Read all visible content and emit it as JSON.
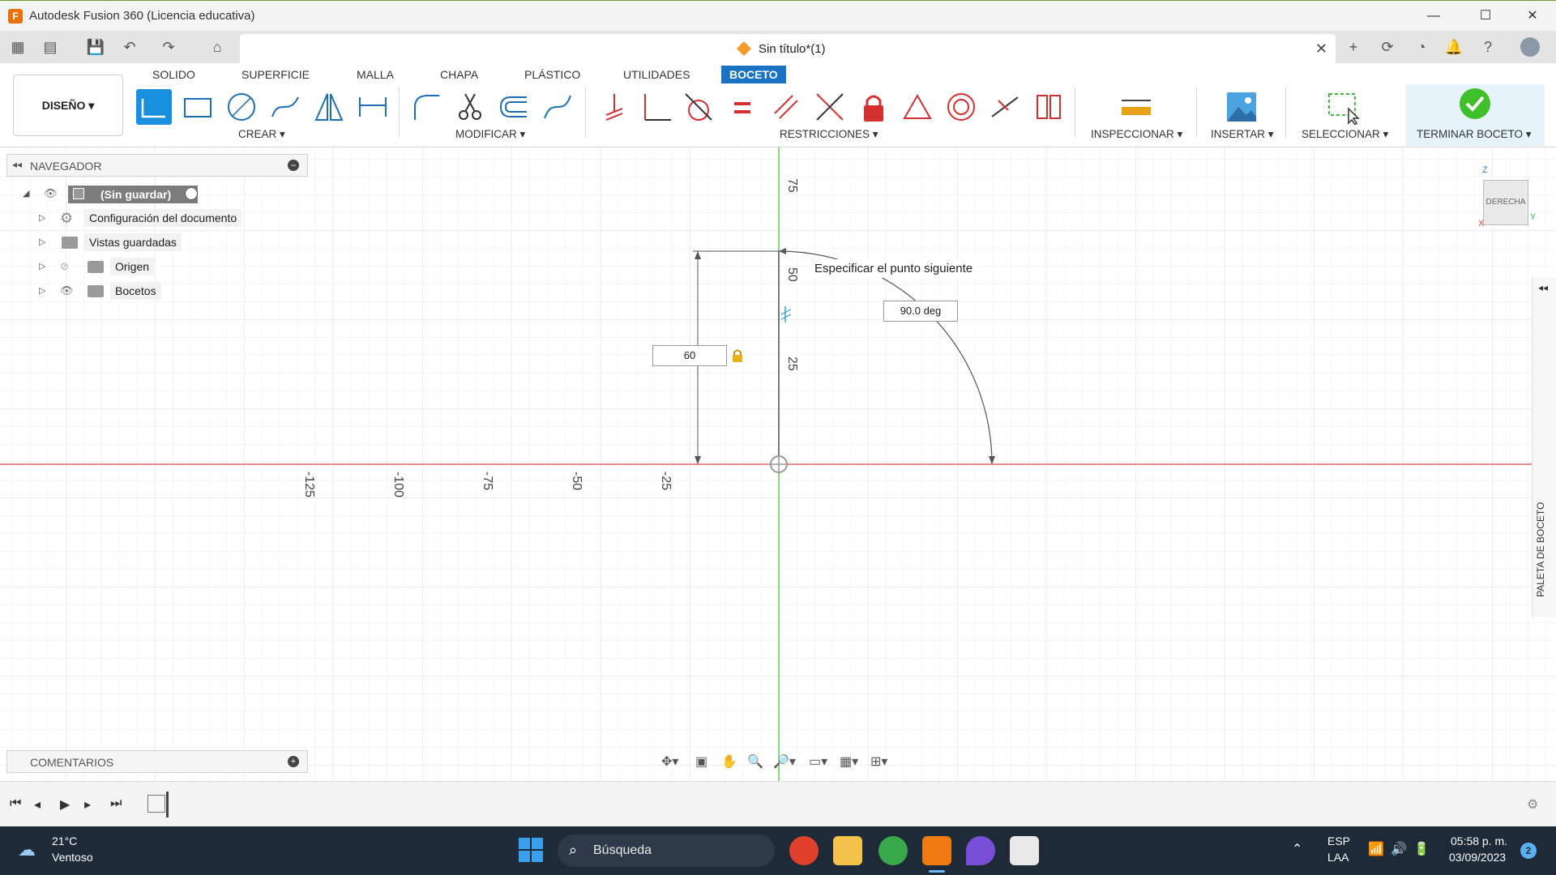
{
  "window": {
    "title": "Autodesk Fusion 360 (Licencia educativa)",
    "app_icon": "F"
  },
  "doc_tab": {
    "title": "Sin título*(1)"
  },
  "ribbon": {
    "workspace": "DISEÑO ▾",
    "tabs": [
      "SOLIDO",
      "SUPERFICIE",
      "MALLA",
      "CHAPA",
      "PLÁSTICO",
      "UTILIDADES",
      "BOCETO"
    ],
    "active_tab": "BOCETO",
    "groups": {
      "crear": "CREAR ▾",
      "modificar": "MODIFICAR ▾",
      "restricciones": "RESTRICCIONES ▾",
      "inspeccionar": "INSPECCIONAR ▾",
      "insertar": "INSERTAR ▾",
      "seleccionar": "SELECCIONAR ▾",
      "terminar": "TERMINAR BOCETO ▾"
    }
  },
  "navigator": {
    "header": "NAVEGADOR",
    "root": "(Sin guardar)",
    "items": [
      "Configuración del documento",
      "Vistas guardadas",
      "Origen",
      "Bocetos"
    ]
  },
  "comments": {
    "header": "COMENTARIOS"
  },
  "sketch": {
    "tooltip": "Especificar el punto siguiente",
    "length_input": "60",
    "angle_input": "90.0 deg",
    "x_ticks": [
      "-125",
      "-100",
      "-75",
      "-50",
      "-25"
    ],
    "y_ticks": [
      "75",
      "50",
      "25"
    ]
  },
  "palette": {
    "label": "PALETA DE BOCETO"
  },
  "viewcube": {
    "face": "DERECHA",
    "axis_z": "Z",
    "axis_y": "Y",
    "axis_x": "X"
  },
  "taskbar": {
    "weather_temp": "21°C",
    "weather_desc": "Ventoso",
    "search_placeholder": "Búsqueda",
    "lang": "ESP",
    "layout": "LAA",
    "time": "05:58 p. m.",
    "date": "03/09/2023",
    "notif_count": "2"
  },
  "colors": {
    "accent": "#1a72c4",
    "x_axis": "#e04848",
    "y_axis": "#3bbf3b",
    "finish": "#3fbf2a"
  }
}
